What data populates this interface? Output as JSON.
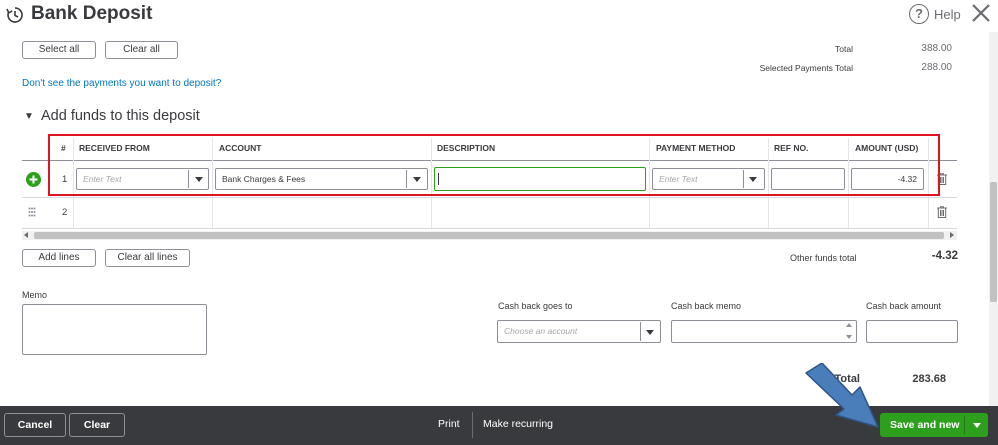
{
  "header": {
    "title": "Bank Deposit",
    "help_label": "Help",
    "help_glyph": "?"
  },
  "top_buttons": {
    "select_all": "Select all",
    "clear_all": "Clear all"
  },
  "summary": {
    "total_label": "Total",
    "total_value": "388.00",
    "selected_label": "Selected Payments Total",
    "selected_value": "288.00"
  },
  "payments_link": "Don't see the payments you want to deposit?",
  "add_funds": {
    "toggle_glyph": "▼",
    "title": "Add funds to this deposit",
    "columns": [
      "#",
      "RECEIVED FROM",
      "ACCOUNT",
      "DESCRIPTION",
      "PAYMENT METHOD",
      "REF NO.",
      "AMOUNT (USD)"
    ],
    "rows": [
      {
        "num": "1",
        "received_from_placeholder": "Enter Text",
        "account": "Bank Charges & Fees",
        "description": "",
        "payment_method_placeholder": "Enter Text",
        "ref_no": "",
        "amount": "-4.32"
      },
      {
        "num": "2"
      }
    ]
  },
  "table_buttons": {
    "add_lines": "Add lines",
    "clear_all_lines": "Clear all lines"
  },
  "other_funds": {
    "label": "Other funds total",
    "value": "-4.32"
  },
  "memo": {
    "label": "Memo",
    "value": ""
  },
  "cash_back": {
    "goes_to_label": "Cash back goes to",
    "goes_to_placeholder": "Choose an account",
    "memo_label": "Cash back memo",
    "amount_label": "Cash back amount"
  },
  "bottom_total": {
    "label": "Total",
    "value": "283.68"
  },
  "footer": {
    "cancel": "Cancel",
    "clear": "Clear",
    "print": "Print",
    "make_recurring": "Make recurring",
    "save_and_new": "Save and new"
  },
  "colors": {
    "primary_green": "#2ca01c",
    "footer_bg": "#393a3d",
    "link_blue": "#0077c5",
    "highlight_red": "#e0141e",
    "annotation_arrow": "#4a7ebb"
  }
}
